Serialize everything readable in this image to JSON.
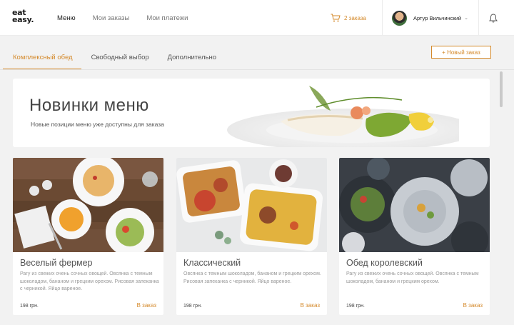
{
  "header": {
    "logo_line1": "eat",
    "logo_line2": "easy.",
    "nav": [
      {
        "label": "Меню",
        "active": true
      },
      {
        "label": "Мои заказы",
        "active": false
      },
      {
        "label": "Мои платежи",
        "active": false
      }
    ],
    "cart_label": "2 заказа",
    "user_name": "Артур Вильчинский",
    "icons": {
      "cart": "cart-icon",
      "bell": "bell-icon",
      "chevron": "chevron-down-icon"
    }
  },
  "tabs": [
    {
      "label": "Комплексный обед",
      "active": true
    },
    {
      "label": "Свободный выбор",
      "active": false
    },
    {
      "label": "Дополнительно",
      "active": false
    }
  ],
  "new_order_label": "+ Новый заказ",
  "banner": {
    "title": "Новинки меню",
    "subtitle": "Новые позиции меню уже доступны для заказа"
  },
  "cards": [
    {
      "title": "Веселый фермер",
      "desc": "Рагу из свежих очень сочных овощей. Овсянка с темным шоколадом, бананом и грецким орехом. Рисовая запеканка с черникой. Яйцо вареное.",
      "price": "198 грн.",
      "order_label": "В заказ"
    },
    {
      "title": "Классический",
      "desc": "Овсянка с темным шоколадом, бананом и грецким орехом. Рисовая запеканка с черникой. Яйцо вареное.",
      "price": "198 грн.",
      "order_label": "В заказ"
    },
    {
      "title": "Обед королевский",
      "desc": "Рагу из свежих очень сочных овощей. Овсянка с темным шоколадом, бананом и грецким орехом.",
      "price": "198 грн.",
      "order_label": "В заказ"
    }
  ],
  "colors": {
    "accent": "#d4892a",
    "background": "#f2f2f2"
  }
}
